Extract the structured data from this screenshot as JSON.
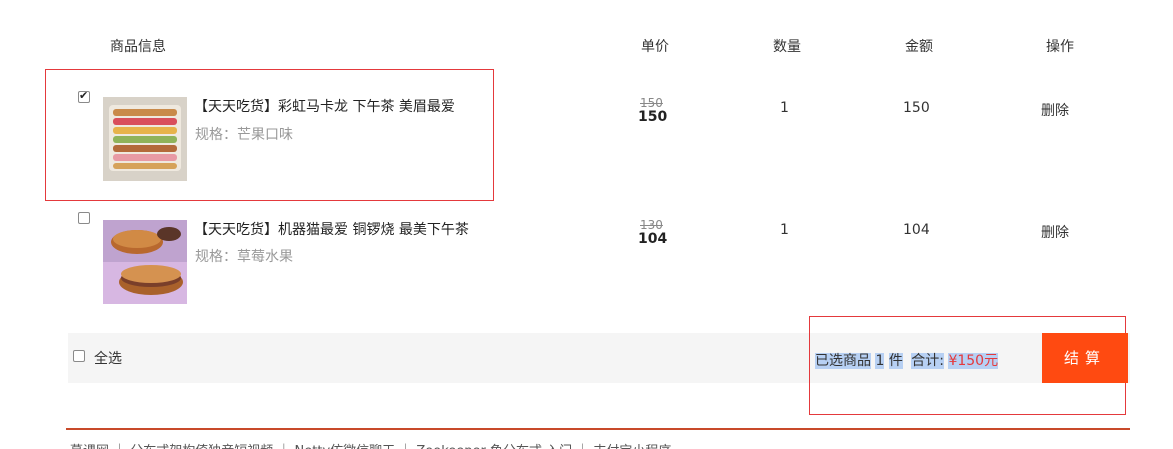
{
  "header": {
    "product_info": "商品信息",
    "unit_price": "单价",
    "quantity": "数量",
    "amount": "金额",
    "operation": "操作"
  },
  "items": [
    {
      "checked": true,
      "title": "【天天吃货】彩虹马卡龙 下午茶 美眉最爱",
      "spec": "规格：芒果口味",
      "old_price": "150",
      "price": "150",
      "quantity": "1",
      "amount": "150",
      "delete_label": "删除"
    },
    {
      "checked": false,
      "title": "【天天吃货】机器猫最爱 铜锣烧 最美下午茶",
      "spec": "规格：草莓水果",
      "old_price": "130",
      "price": "104",
      "quantity": "1",
      "amount": "104",
      "delete_label": "删除"
    }
  ],
  "summary": {
    "select_all_label": "全选",
    "selected_prefix": "已选商品",
    "selected_count": "1",
    "selected_unit": "件",
    "total_label": "合计:",
    "total_value": "¥150元",
    "pay_label": "结算"
  },
  "footer": {
    "text": "慕课网 ｜ 分布式架构倚独音短视频 ｜ Netty仿微信聊天 ｜ Zookeeper 鱼分布式 入门 ｜ 支付宝小程序"
  },
  "colors": {
    "accent": "#ff4a11",
    "highlight_border": "#e4393c",
    "selection": "#b7d0f3"
  }
}
